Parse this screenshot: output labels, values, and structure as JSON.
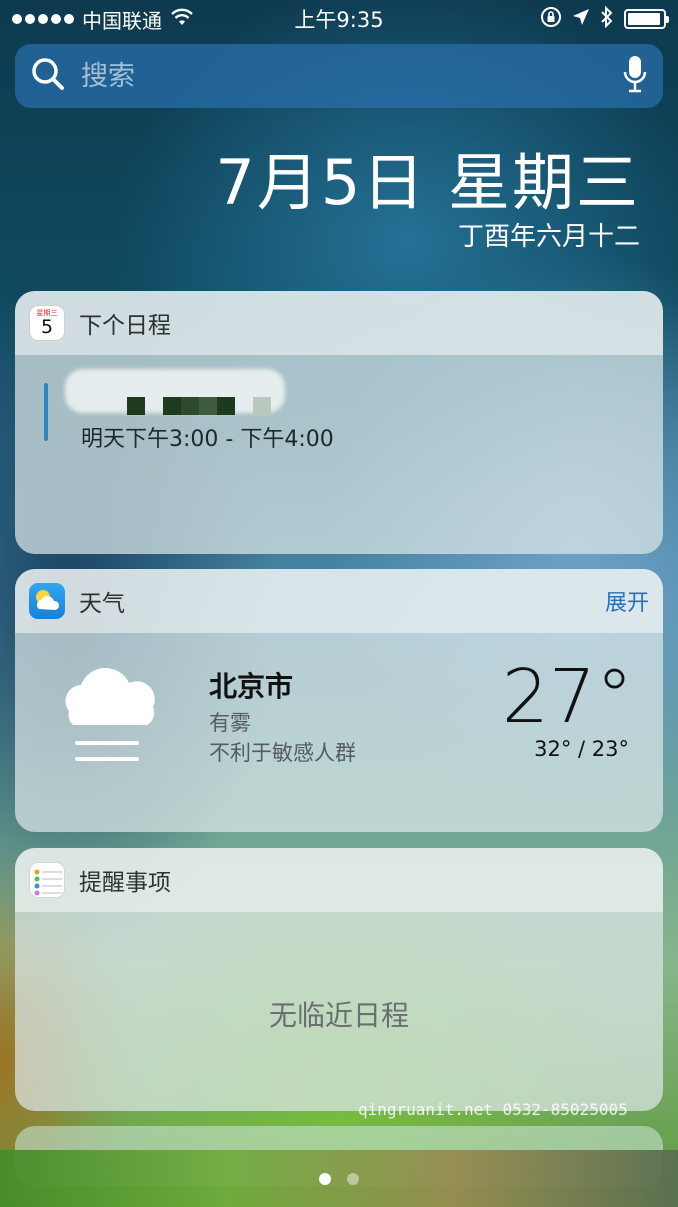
{
  "status_bar": {
    "carrier": "中国联通",
    "time": "上午9:35",
    "signal_dots": 5,
    "battery_level": 0.95
  },
  "search": {
    "placeholder": "搜索"
  },
  "date": {
    "main": "7月5日 星期三",
    "lunar": "丁酉年六月十二"
  },
  "calendar_widget": {
    "title": "下个日程",
    "icon_weekday": "星期三",
    "icon_day": "5",
    "event_time": "明天下午3:00 - 下午4:00"
  },
  "weather_widget": {
    "title": "天气",
    "expand_label": "展开",
    "city": "北京市",
    "condition": "有雾",
    "air_quality": "不利于敏感人群",
    "temperature": "27°",
    "range": "32° / 23°"
  },
  "reminders_widget": {
    "title": "提醒事项",
    "empty_text": "无临近日程"
  },
  "next_widget": {
    "title": ""
  },
  "page_indicator": {
    "count": 2,
    "active": 0
  },
  "watermark": "qingruanit.net 0532-85025005",
  "colors": {
    "accent": "#2b6fb8",
    "calendar_bar": "#2d86c0"
  }
}
